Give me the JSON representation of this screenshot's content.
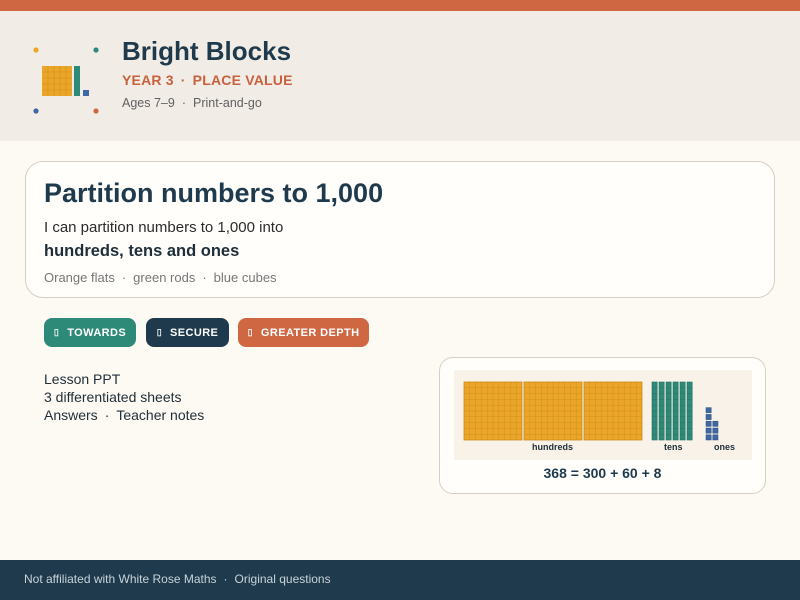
{
  "brand": {
    "title": "Bright Blocks",
    "year": "YEAR 3",
    "topic": "PLACE VALUE",
    "ages": "Ages 7–9",
    "format": "Print-and-go"
  },
  "lesson": {
    "title": "Partition numbers to 1,000",
    "objective_line1": "I can partition numbers to 1,000 into",
    "objective_line2": "hundreds, tens and ones",
    "materials": [
      "Orange flats",
      "green rods",
      "blue cubes"
    ]
  },
  "levels": [
    {
      "label": "TOWARDS",
      "icon": "dot-icon",
      "color": "#2e8a78"
    },
    {
      "label": "SECURE",
      "icon": "dot-icon",
      "color": "#1e3a4c"
    },
    {
      "label": "GREATER DEPTH",
      "icon": "dot-icon",
      "color": "#cf6743"
    }
  ],
  "resources": {
    "line1": "Lesson PPT",
    "line2": "3 differentiated sheets",
    "line3_a": "Answers",
    "line3_b": "Teacher notes"
  },
  "preview": {
    "labels": {
      "hundreds": "hundreds",
      "tens": "tens",
      "ones": "ones"
    },
    "counts": {
      "hundreds": 3,
      "tens": 6,
      "ones": 8
    },
    "equation": "368 = 300 + 60 + 8"
  },
  "footer": {
    "left": "Not affiliated with White Rose Maths",
    "right": "Original questions"
  },
  "colors": {
    "accent": "#cf6743",
    "navy": "#1e3a4c",
    "green": "#2e8a78",
    "hundreds_fill": "#eba62a",
    "tens_fill": "#2e8a78",
    "ones_fill": "#3f67a3"
  }
}
